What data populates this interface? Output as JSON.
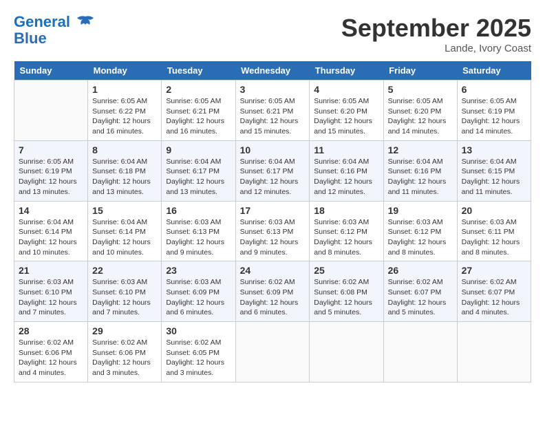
{
  "header": {
    "logo_line1": "General",
    "logo_line2": "Blue",
    "month": "September 2025",
    "location": "Lande, Ivory Coast"
  },
  "columns": [
    "Sunday",
    "Monday",
    "Tuesday",
    "Wednesday",
    "Thursday",
    "Friday",
    "Saturday"
  ],
  "weeks": [
    [
      {
        "day": "",
        "empty": true
      },
      {
        "day": "1",
        "sunrise": "6:05 AM",
        "sunset": "6:22 PM",
        "daylight": "12 hours and 16 minutes."
      },
      {
        "day": "2",
        "sunrise": "6:05 AM",
        "sunset": "6:21 PM",
        "daylight": "12 hours and 16 minutes."
      },
      {
        "day": "3",
        "sunrise": "6:05 AM",
        "sunset": "6:21 PM",
        "daylight": "12 hours and 15 minutes."
      },
      {
        "day": "4",
        "sunrise": "6:05 AM",
        "sunset": "6:20 PM",
        "daylight": "12 hours and 15 minutes."
      },
      {
        "day": "5",
        "sunrise": "6:05 AM",
        "sunset": "6:20 PM",
        "daylight": "12 hours and 14 minutes."
      },
      {
        "day": "6",
        "sunrise": "6:05 AM",
        "sunset": "6:19 PM",
        "daylight": "12 hours and 14 minutes."
      }
    ],
    [
      {
        "day": "7",
        "sunrise": "6:05 AM",
        "sunset": "6:19 PM",
        "daylight": "12 hours and 13 minutes."
      },
      {
        "day": "8",
        "sunrise": "6:04 AM",
        "sunset": "6:18 PM",
        "daylight": "12 hours and 13 minutes."
      },
      {
        "day": "9",
        "sunrise": "6:04 AM",
        "sunset": "6:17 PM",
        "daylight": "12 hours and 13 minutes."
      },
      {
        "day": "10",
        "sunrise": "6:04 AM",
        "sunset": "6:17 PM",
        "daylight": "12 hours and 12 minutes."
      },
      {
        "day": "11",
        "sunrise": "6:04 AM",
        "sunset": "6:16 PM",
        "daylight": "12 hours and 12 minutes."
      },
      {
        "day": "12",
        "sunrise": "6:04 AM",
        "sunset": "6:16 PM",
        "daylight": "12 hours and 11 minutes."
      },
      {
        "day": "13",
        "sunrise": "6:04 AM",
        "sunset": "6:15 PM",
        "daylight": "12 hours and 11 minutes."
      }
    ],
    [
      {
        "day": "14",
        "sunrise": "6:04 AM",
        "sunset": "6:14 PM",
        "daylight": "12 hours and 10 minutes."
      },
      {
        "day": "15",
        "sunrise": "6:04 AM",
        "sunset": "6:14 PM",
        "daylight": "12 hours and 10 minutes."
      },
      {
        "day": "16",
        "sunrise": "6:03 AM",
        "sunset": "6:13 PM",
        "daylight": "12 hours and 9 minutes."
      },
      {
        "day": "17",
        "sunrise": "6:03 AM",
        "sunset": "6:13 PM",
        "daylight": "12 hours and 9 minutes."
      },
      {
        "day": "18",
        "sunrise": "6:03 AM",
        "sunset": "6:12 PM",
        "daylight": "12 hours and 8 minutes."
      },
      {
        "day": "19",
        "sunrise": "6:03 AM",
        "sunset": "6:12 PM",
        "daylight": "12 hours and 8 minutes."
      },
      {
        "day": "20",
        "sunrise": "6:03 AM",
        "sunset": "6:11 PM",
        "daylight": "12 hours and 8 minutes."
      }
    ],
    [
      {
        "day": "21",
        "sunrise": "6:03 AM",
        "sunset": "6:10 PM",
        "daylight": "12 hours and 7 minutes."
      },
      {
        "day": "22",
        "sunrise": "6:03 AM",
        "sunset": "6:10 PM",
        "daylight": "12 hours and 7 minutes."
      },
      {
        "day": "23",
        "sunrise": "6:03 AM",
        "sunset": "6:09 PM",
        "daylight": "12 hours and 6 minutes."
      },
      {
        "day": "24",
        "sunrise": "6:02 AM",
        "sunset": "6:09 PM",
        "daylight": "12 hours and 6 minutes."
      },
      {
        "day": "25",
        "sunrise": "6:02 AM",
        "sunset": "6:08 PM",
        "daylight": "12 hours and 5 minutes."
      },
      {
        "day": "26",
        "sunrise": "6:02 AM",
        "sunset": "6:07 PM",
        "daylight": "12 hours and 5 minutes."
      },
      {
        "day": "27",
        "sunrise": "6:02 AM",
        "sunset": "6:07 PM",
        "daylight": "12 hours and 4 minutes."
      }
    ],
    [
      {
        "day": "28",
        "sunrise": "6:02 AM",
        "sunset": "6:06 PM",
        "daylight": "12 hours and 4 minutes."
      },
      {
        "day": "29",
        "sunrise": "6:02 AM",
        "sunset": "6:06 PM",
        "daylight": "12 hours and 3 minutes."
      },
      {
        "day": "30",
        "sunrise": "6:02 AM",
        "sunset": "6:05 PM",
        "daylight": "12 hours and 3 minutes."
      },
      {
        "day": "",
        "empty": true
      },
      {
        "day": "",
        "empty": true
      },
      {
        "day": "",
        "empty": true
      },
      {
        "day": "",
        "empty": true
      }
    ]
  ]
}
